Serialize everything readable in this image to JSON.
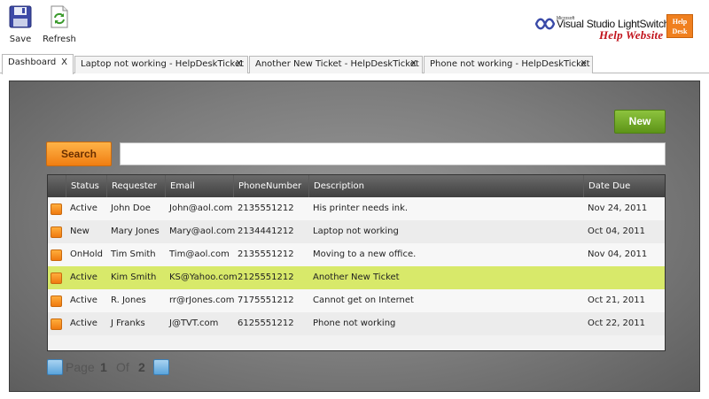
{
  "toolbar": {
    "save_label": "Save",
    "refresh_label": "Refresh"
  },
  "logo": {
    "microsoft": "Microsoft",
    "product": "Visual Studio LightSwitch",
    "tagline": "Help Website",
    "badge_line1": "Help",
    "badge_line2": "Desk"
  },
  "tabs": [
    {
      "label": "Dashboard",
      "close": "X"
    },
    {
      "label": "Laptop not working - HelpDeskTicket",
      "close": "X"
    },
    {
      "label": "Another New Ticket - HelpDeskTicket",
      "close": "X"
    },
    {
      "label": "Phone not working - HelpDeskTicket",
      "close": "X"
    }
  ],
  "main": {
    "new_label": "New",
    "search_label": "Search",
    "search_value": ""
  },
  "table": {
    "headers": [
      "Status",
      "Requester",
      "Email",
      "PhoneNumber",
      "Description",
      "Date Due"
    ],
    "rows": [
      [
        "Active",
        "John Doe",
        "John@aol.com",
        "2135551212",
        "His printer needs ink.",
        "Nov 24, 2011"
      ],
      [
        "New",
        "Mary Jones",
        "Mary@aol.com",
        "2134441212",
        "Laptop not working",
        "Oct 04, 2011"
      ],
      [
        "OnHold",
        "Tim Smith",
        "Tim@aol.com",
        "2135551212",
        "Moving to a new office.",
        "Nov 04, 2011"
      ],
      [
        "Active",
        "Kim Smith",
        "KS@Yahoo.com",
        "2125551212",
        "Another New Ticket",
        ""
      ],
      [
        "Active",
        "R. Jones",
        "rr@rJones.com",
        "7175551212",
        "Cannot get on Internet",
        "Oct 21, 2011"
      ],
      [
        "Active",
        "J Franks",
        "J@TVT.com",
        "6125551212",
        "Phone not working",
        "Oct 22, 2011"
      ]
    ],
    "selected_row": 3
  },
  "pager": {
    "page_word": "Page",
    "current": "1",
    "of_word": "Of",
    "total": "2"
  },
  "colors": {
    "accent_green": "#6ea826",
    "accent_orange": "#f28a1d",
    "selected_row": "#d8e96a"
  }
}
